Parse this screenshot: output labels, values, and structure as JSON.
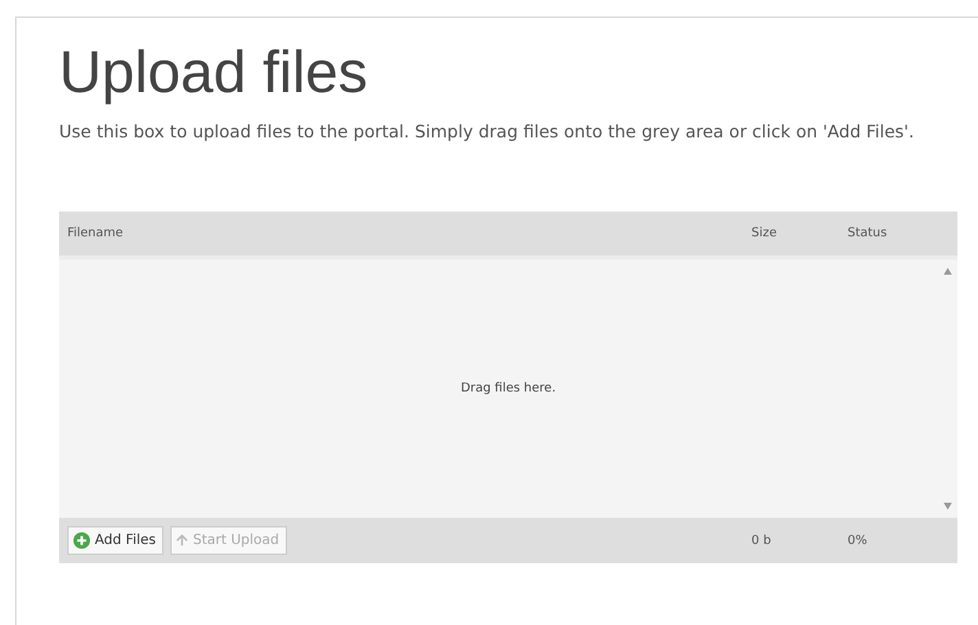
{
  "title": "Upload files",
  "description": "Use this box to upload files to the portal. Simply drag files onto the grey area or click on 'Add Files'.",
  "table": {
    "columns": [
      "Filename",
      "Size",
      "Status"
    ],
    "empty_text": "Drag files here.",
    "footer": {
      "buttons": [
        {
          "label": "Add Files",
          "kind": "add",
          "disabled": false
        },
        {
          "label": "Start Upload",
          "kind": "start",
          "disabled": true
        }
      ],
      "total_size": "0 b",
      "total_status": "0%"
    }
  }
}
